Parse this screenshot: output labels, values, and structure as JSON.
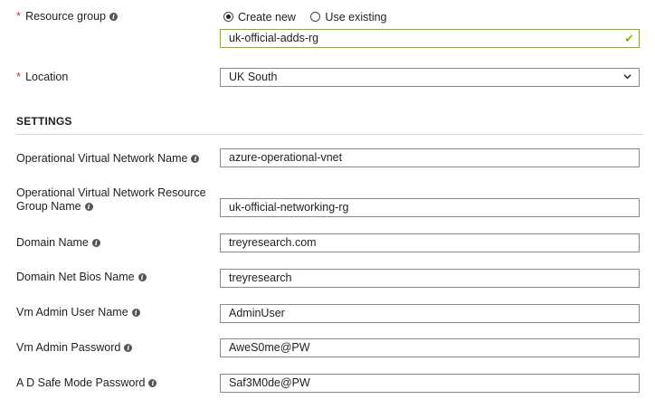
{
  "resource_group": {
    "label": "Resource group",
    "required_mark": "*",
    "options": [
      "Create new",
      "Use existing"
    ],
    "selected_option": "Create new",
    "value": "uk-official-adds-rg"
  },
  "location": {
    "label": "Location",
    "required_mark": "*",
    "value": "UK South"
  },
  "settings": {
    "title": "SETTINGS",
    "fields": [
      {
        "label": "Operational Virtual Network Name",
        "value": "azure-operational-vnet"
      },
      {
        "label_line1": "Operational Virtual Network Resource",
        "label_line2": "Group Name",
        "value": "uk-official-networking-rg"
      },
      {
        "label": "Domain Name",
        "value": "treyresearch.com"
      },
      {
        "label": "Domain Net Bios Name",
        "value": "treyresearch"
      },
      {
        "label": "Vm Admin User Name",
        "value": "AdminUser"
      },
      {
        "label": "Vm Admin Password",
        "value": "AweS0me@PW"
      },
      {
        "label": "A D Safe Mode Password",
        "value": "Saf3M0de@PW"
      }
    ]
  },
  "colors": {
    "valid": "#7fba00",
    "required": "#c0392b",
    "border": "#8a8a8a"
  },
  "icons": [
    "info-icon",
    "checkmark-icon",
    "chevron-down-icon",
    "radio-icon"
  ]
}
